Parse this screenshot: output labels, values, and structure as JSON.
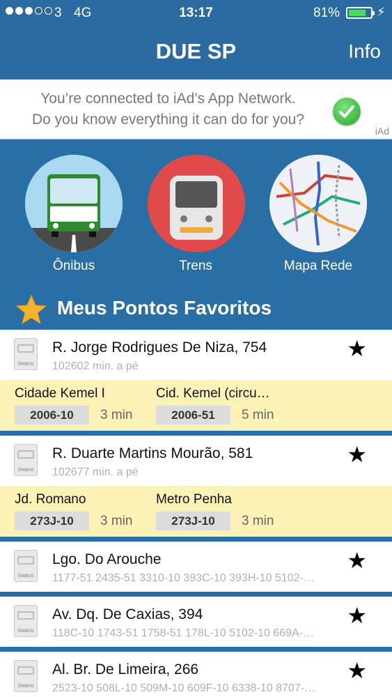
{
  "status": {
    "carrier": "3",
    "network": "4G",
    "time": "13:17",
    "battery_pct": "81%",
    "battery_level": 0.81,
    "charging_icon": "bolt-icon",
    "signal_bars": [
      true,
      true,
      true,
      false,
      false
    ]
  },
  "nav": {
    "title": "DUE SP",
    "info_label": "Info"
  },
  "ad": {
    "line1": "You’re connected to iAd’s App Network.",
    "line2": "Do you know everything it can do for you?",
    "badge": "iAd"
  },
  "categories": [
    {
      "label": "Ônibus",
      "icon": "bus-icon"
    },
    {
      "label": "Trens",
      "icon": "train-icon"
    },
    {
      "label": "Mapa Rede",
      "icon": "map-icon"
    }
  ],
  "favorites": {
    "title": "Meus Pontos Favoritos",
    "stops": [
      {
        "name": "R. Jorge Rodrigues De Niza, 754",
        "sub": "102602 min. a pé",
        "arrivals": [
          {
            "name": "Cidade Kemel I",
            "code": "2006-10",
            "mins": "3 min"
          },
          {
            "name": "Cid. Kemel (circu…",
            "code": "2006-51",
            "mins": "5 min"
          }
        ]
      },
      {
        "name": "R. Duarte Martins Mourão, 581",
        "sub": "102677 min. a pé",
        "arrivals": [
          {
            "name": "Jd. Romano",
            "code": "273J-10",
            "mins": "3 min"
          },
          {
            "name": "Metro Penha",
            "code": "273J-10",
            "mins": "3 min"
          }
        ]
      },
      {
        "name": "Lgo. Do Arouche",
        "sub": "1177-51 2435-51 3310-10 393C-10 393H-10 5102-…"
      },
      {
        "name": "Av. Dq. De Caxias, 394",
        "sub": "118C-10 1743-51 1758-51 178L-10 5102-10 669A-…"
      },
      {
        "name": "Al. Br. De Limeira, 266",
        "sub": "2523-10 508L-10 509M-10 609F-10 6338-10 8707-…"
      }
    ],
    "stop_icon_text": "ÔNIBUS"
  }
}
